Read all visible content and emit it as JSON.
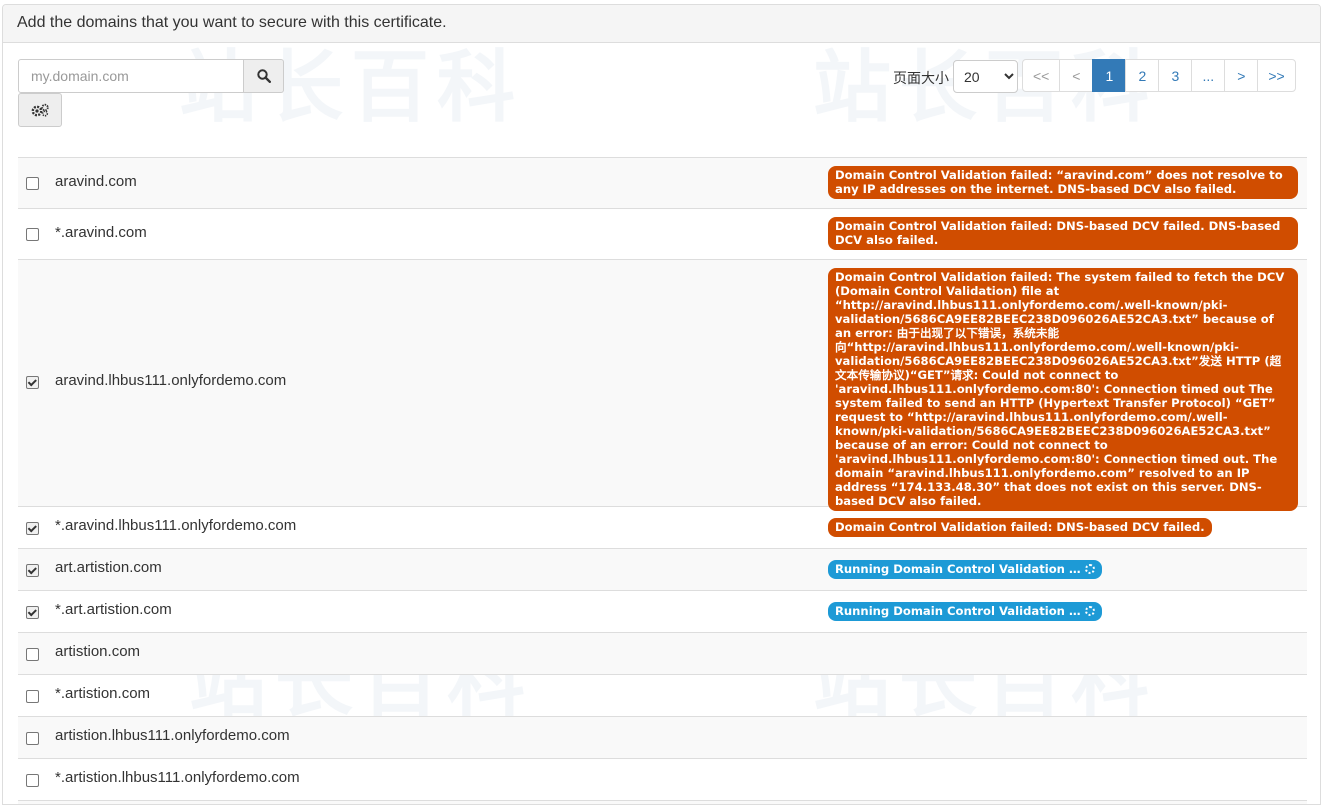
{
  "header": {
    "title": "Add the domains that you want to secure with this certificate."
  },
  "watermark": "站长百科",
  "search": {
    "placeholder": "my.domain.com",
    "value": ""
  },
  "page_size": {
    "label": "页面大小",
    "selected": "20"
  },
  "pagination": {
    "first": "<<",
    "prev": "<",
    "pages": [
      "1",
      "2",
      "3",
      "..."
    ],
    "active_page": "1",
    "next": ">",
    "last": ">>"
  },
  "colors": {
    "danger": "#d04d00",
    "info": "#1d9ad6",
    "primary": "#337ab7"
  },
  "rows": [
    {
      "domain": "aravind.com",
      "checked": false,
      "status_type": "danger",
      "status": "Domain Control Validation failed: “aravind.com” does not resolve to any IP addresses on the internet. DNS-based DCV also failed."
    },
    {
      "domain": "*.aravind.com",
      "checked": false,
      "status_type": "danger",
      "status": "Domain Control Validation failed: DNS-based DCV failed. DNS-based DCV also failed."
    },
    {
      "domain": "aravind.lhbus111.onlyfordemo.com",
      "checked": true,
      "status_type": "danger",
      "status": "Domain Control Validation failed: The system failed to fetch the DCV (Domain Control Validation) file at “http://aravind.lhbus111.onlyfordemo.com/.well-known/pki-validation/5686CA9EE82BEEC238D096026AE52CA3.txt” because of an error: 由于出现了以下错误，系统未能向“http://aravind.lhbus111.onlyfordemo.com/.well-known/pki-validation/5686CA9EE82BEEC238D096026AE52CA3.txt”发送 HTTP (超文本传输协议)“GET”请求: Could not connect to 'aravind.lhbus111.onlyfordemo.com:80': Connection timed out The system failed to send an HTTP (Hypertext Transfer Protocol) “GET” request to “http://aravind.lhbus111.onlyfordemo.com/.well-known/pki-validation/5686CA9EE82BEEC238D096026AE52CA3.txt” because of an error: Could not connect to 'aravind.lhbus111.onlyfordemo.com:80': Connection timed out. The domain “aravind.lhbus111.onlyfordemo.com” resolved to an IP address “174.133.48.30” that does not exist on this server. DNS-based DCV also failed."
    },
    {
      "domain": "*.aravind.lhbus111.onlyfordemo.com",
      "checked": true,
      "status_type": "danger",
      "status": "Domain Control Validation failed: DNS-based DCV failed."
    },
    {
      "domain": "art.artistion.com",
      "checked": true,
      "status_type": "info",
      "status": "Running Domain Control Validation …"
    },
    {
      "domain": "*.art.artistion.com",
      "checked": true,
      "status_type": "info",
      "status": "Running Domain Control Validation …"
    },
    {
      "domain": "artistion.com",
      "checked": false,
      "status_type": "none",
      "status": ""
    },
    {
      "domain": "*.artistion.com",
      "checked": false,
      "status_type": "none",
      "status": ""
    },
    {
      "domain": "artistion.lhbus111.onlyfordemo.com",
      "checked": false,
      "status_type": "none",
      "status": ""
    },
    {
      "domain": "*.artistion.lhbus111.onlyfordemo.com",
      "checked": false,
      "status_type": "none",
      "status": ""
    }
  ]
}
